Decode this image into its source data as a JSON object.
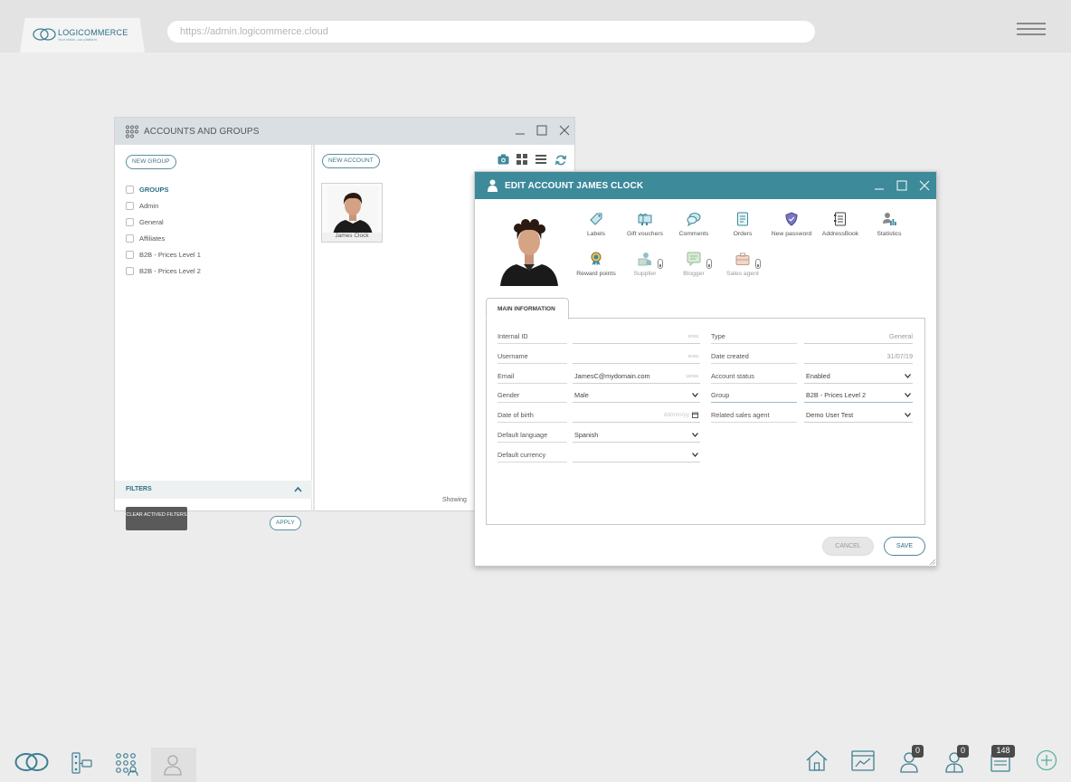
{
  "browser": {
    "logo_text": "LOGICOMMERCE",
    "logo_tagline": "Your vision, our platform",
    "url": "https://admin.logicommerce.cloud"
  },
  "accounts_window": {
    "title": "ACCOUNTS AND GROUPS",
    "new_group_label": "NEW GROUP",
    "new_account_label": "NEW ACCOUNT",
    "groups_header": "GROUPS",
    "groups": [
      "Admin",
      "General",
      "Affiliates",
      "B2B - Prices Level 1",
      "B2B - Prices Level 2"
    ],
    "filters_label": "FILTERS",
    "clear_filters_label": "CLEAR ACTIVED FILTERS",
    "apply_label": "APPLY",
    "card_name": "James Clock",
    "showing_label": "Showing"
  },
  "edit_window": {
    "title": "EDIT ACCOUNT JAMES CLOCK",
    "actions_row1": [
      "Labels",
      "Gift vouchers",
      "Comments",
      "Orders",
      "New password",
      "AddressBook",
      "Statistics"
    ],
    "actions_row2": [
      "Reward points",
      "Supplier",
      "Blogger",
      "Sales agent"
    ],
    "tab_label": "MAIN INFORMATION",
    "fields_left": [
      {
        "label": "Internal ID",
        "value": "",
        "counter": "0/255"
      },
      {
        "label": "Username",
        "value": "",
        "counter": "0/255"
      },
      {
        "label": "Email",
        "value": "JamesC@mydomain.com",
        "counter": "19/255"
      },
      {
        "label": "Gender",
        "value": "Male"
      },
      {
        "label": "Date of birth",
        "placeholder": "dd/mm/yy"
      },
      {
        "label": "Default language",
        "value": "Spanish"
      },
      {
        "label": "Default currency",
        "value": ""
      }
    ],
    "fields_right": [
      {
        "label": "Type",
        "value": "General"
      },
      {
        "label": "Date created",
        "value": "31/07/19"
      },
      {
        "label": "Account status",
        "value": "Enabled"
      },
      {
        "label": "Group",
        "value": "B2B - Prices Level 2"
      },
      {
        "label": "Related sales agent",
        "value": "Demo User Test"
      }
    ],
    "cancel_label": "CANCEL",
    "save_label": "SAVE"
  },
  "taskbar": {
    "badges": {
      "users": "0",
      "groups": "0",
      "messages": "148"
    }
  },
  "colors": {
    "brand_teal": "#3d8a9b",
    "title_bg": "#d9dfe3",
    "background": "#ececec"
  }
}
